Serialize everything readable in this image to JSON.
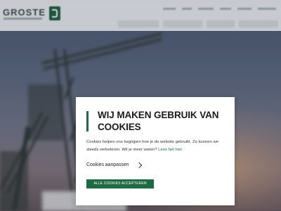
{
  "header": {
    "logo_text": "GROSTE"
  },
  "cookie_dialog": {
    "title": "WIJ MAKEN GEBRUIK VAN COOKIES",
    "body": "Cookies helpen ons begrijpen hoe je de website gebruikt. Zo kunnen we steeds verbeteren. Wil je meer weten? ",
    "read_more_link": "Lees het hier.",
    "customize_label": "Cookies aanpassen",
    "accept_label": "ALLE COOKIES ACCEPTEREN"
  },
  "colors": {
    "accent": "#1f6a45",
    "dialog_background": "#ffffff",
    "header_background": "#e8ebee"
  },
  "icons": {
    "customize_chevron": "chevron-right-icon"
  }
}
